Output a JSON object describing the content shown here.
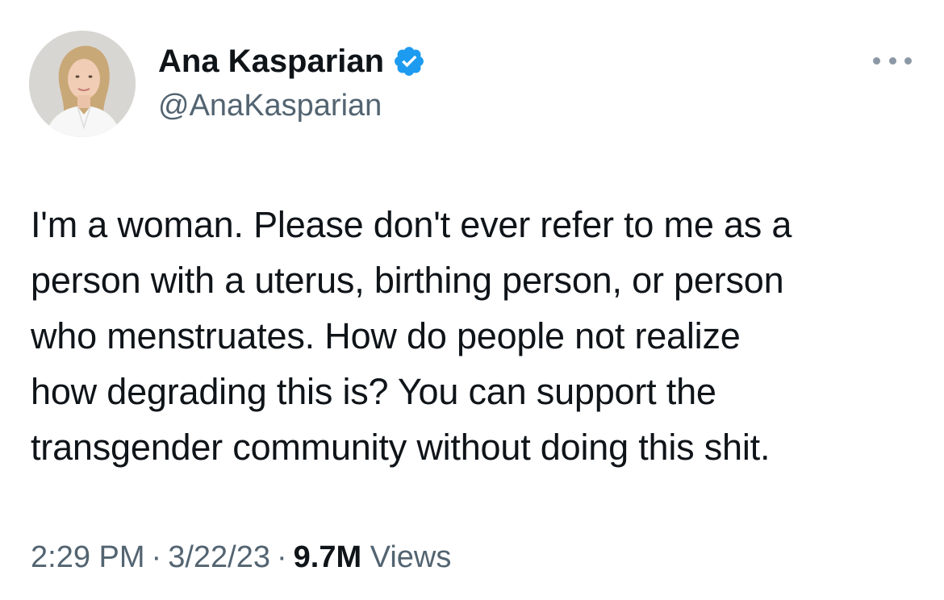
{
  "author": {
    "name": "Ana Kasparian",
    "handle": "@AnaKasparian",
    "verified": true,
    "verified_color": "#1d9bf0"
  },
  "tweet": {
    "lines": [
      "I'm a woman. Please don't ever refer to me as a",
      "person with a uterus, birthing person, or person",
      "who menstruates. How do people not realize",
      "how degrading this is? You can support the",
      "transgender community without doing this shit."
    ]
  },
  "meta": {
    "time": "2:29 PM",
    "separator": "·",
    "date": "3/22/23",
    "views_count": "9.7M",
    "views_label": "Views"
  },
  "icons": {
    "avatar": "avatar-photo",
    "badge": "verified-badge-icon",
    "more": "more-options-icon"
  }
}
